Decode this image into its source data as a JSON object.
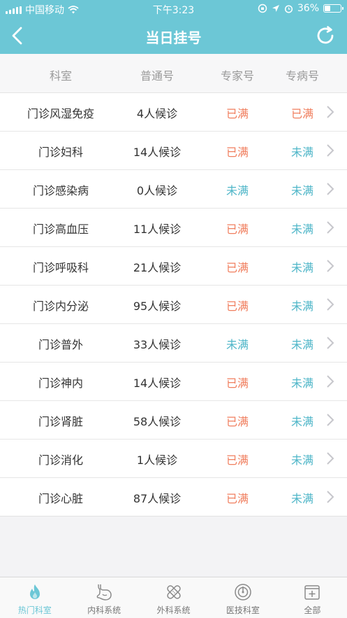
{
  "status_bar": {
    "carrier": "中国移动",
    "time": "下午3:23",
    "battery": "36%",
    "battery_level": 0.36
  },
  "nav": {
    "title": "当日挂号"
  },
  "columns": [
    "科室",
    "普通号",
    "专家号",
    "专病号"
  ],
  "rows": [
    {
      "dept": "门诊风湿免疫",
      "wait": "4人候诊",
      "expert": "已满",
      "special": "已满"
    },
    {
      "dept": "门诊妇科",
      "wait": "14人候诊",
      "expert": "已满",
      "special": "未满"
    },
    {
      "dept": "门诊感染病",
      "wait": "0人候诊",
      "expert": "未满",
      "special": "未满"
    },
    {
      "dept": "门诊高血压",
      "wait": "11人候诊",
      "expert": "已满",
      "special": "未满"
    },
    {
      "dept": "门诊呼吸科",
      "wait": "21人候诊",
      "expert": "已满",
      "special": "未满"
    },
    {
      "dept": "门诊内分泌",
      "wait": "95人候诊",
      "expert": "已满",
      "special": "未满"
    },
    {
      "dept": "门诊普外",
      "wait": "33人候诊",
      "expert": "未满",
      "special": "未满"
    },
    {
      "dept": "门诊神内",
      "wait": "14人候诊",
      "expert": "已满",
      "special": "未满"
    },
    {
      "dept": "门诊肾脏",
      "wait": "58人候诊",
      "expert": "已满",
      "special": "未满"
    },
    {
      "dept": "门诊消化",
      "wait": "1人候诊",
      "expert": "已满",
      "special": "未满"
    },
    {
      "dept": "门诊心脏",
      "wait": "87人候诊",
      "expert": "已满",
      "special": "未满"
    }
  ],
  "tabs": [
    {
      "label": "热门科室",
      "icon": "flame-icon",
      "active": true
    },
    {
      "label": "内科系统",
      "icon": "stomach-icon",
      "active": false
    },
    {
      "label": "外科系统",
      "icon": "bandage-icon",
      "active": false
    },
    {
      "label": "医技科室",
      "icon": "target-icon",
      "active": false
    },
    {
      "label": "全部",
      "icon": "plus-box-icon",
      "active": false
    }
  ],
  "colors": {
    "accent": "#6cc7d6",
    "full": "#f07e5e",
    "not_full": "#4fb6c8"
  }
}
